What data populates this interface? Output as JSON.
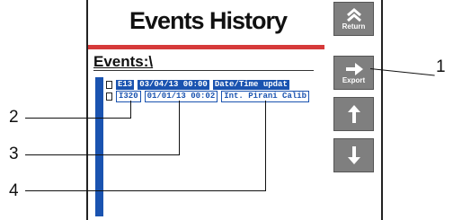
{
  "header": {
    "title": "Events History"
  },
  "folder": {
    "path": "Events:\\"
  },
  "events": [
    {
      "code": "E13",
      "datetime": "03/04/13 00:00",
      "description": "Date/Time updat"
    },
    {
      "code": "I320",
      "datetime": "01/01/13 00:02",
      "description": "Int. Pirani Calib"
    }
  ],
  "buttons": {
    "return_label": "Return",
    "export_label": "Export"
  },
  "callouts": {
    "c1": "1",
    "c2": "2",
    "c3": "3",
    "c4": "4"
  }
}
